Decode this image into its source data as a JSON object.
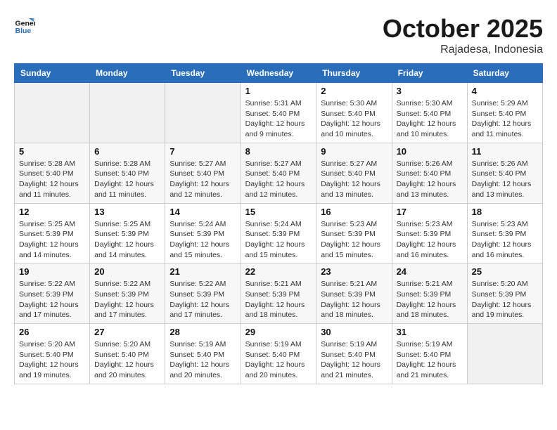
{
  "header": {
    "logo_line1": "General",
    "logo_line2": "Blue",
    "month": "October 2025",
    "location": "Rajadesa, Indonesia"
  },
  "weekdays": [
    "Sunday",
    "Monday",
    "Tuesday",
    "Wednesday",
    "Thursday",
    "Friday",
    "Saturday"
  ],
  "weeks": [
    [
      {
        "day": "",
        "sunrise": "",
        "sunset": "",
        "daylight": ""
      },
      {
        "day": "",
        "sunrise": "",
        "sunset": "",
        "daylight": ""
      },
      {
        "day": "",
        "sunrise": "",
        "sunset": "",
        "daylight": ""
      },
      {
        "day": "1",
        "sunrise": "Sunrise: 5:31 AM",
        "sunset": "Sunset: 5:40 PM",
        "daylight": "Daylight: 12 hours and 9 minutes."
      },
      {
        "day": "2",
        "sunrise": "Sunrise: 5:30 AM",
        "sunset": "Sunset: 5:40 PM",
        "daylight": "Daylight: 12 hours and 10 minutes."
      },
      {
        "day": "3",
        "sunrise": "Sunrise: 5:30 AM",
        "sunset": "Sunset: 5:40 PM",
        "daylight": "Daylight: 12 hours and 10 minutes."
      },
      {
        "day": "4",
        "sunrise": "Sunrise: 5:29 AM",
        "sunset": "Sunset: 5:40 PM",
        "daylight": "Daylight: 12 hours and 11 minutes."
      }
    ],
    [
      {
        "day": "5",
        "sunrise": "Sunrise: 5:28 AM",
        "sunset": "Sunset: 5:40 PM",
        "daylight": "Daylight: 12 hours and 11 minutes."
      },
      {
        "day": "6",
        "sunrise": "Sunrise: 5:28 AM",
        "sunset": "Sunset: 5:40 PM",
        "daylight": "Daylight: 12 hours and 11 minutes."
      },
      {
        "day": "7",
        "sunrise": "Sunrise: 5:27 AM",
        "sunset": "Sunset: 5:40 PM",
        "daylight": "Daylight: 12 hours and 12 minutes."
      },
      {
        "day": "8",
        "sunrise": "Sunrise: 5:27 AM",
        "sunset": "Sunset: 5:40 PM",
        "daylight": "Daylight: 12 hours and 12 minutes."
      },
      {
        "day": "9",
        "sunrise": "Sunrise: 5:27 AM",
        "sunset": "Sunset: 5:40 PM",
        "daylight": "Daylight: 12 hours and 13 minutes."
      },
      {
        "day": "10",
        "sunrise": "Sunrise: 5:26 AM",
        "sunset": "Sunset: 5:40 PM",
        "daylight": "Daylight: 12 hours and 13 minutes."
      },
      {
        "day": "11",
        "sunrise": "Sunrise: 5:26 AM",
        "sunset": "Sunset: 5:40 PM",
        "daylight": "Daylight: 12 hours and 13 minutes."
      }
    ],
    [
      {
        "day": "12",
        "sunrise": "Sunrise: 5:25 AM",
        "sunset": "Sunset: 5:39 PM",
        "daylight": "Daylight: 12 hours and 14 minutes."
      },
      {
        "day": "13",
        "sunrise": "Sunrise: 5:25 AM",
        "sunset": "Sunset: 5:39 PM",
        "daylight": "Daylight: 12 hours and 14 minutes."
      },
      {
        "day": "14",
        "sunrise": "Sunrise: 5:24 AM",
        "sunset": "Sunset: 5:39 PM",
        "daylight": "Daylight: 12 hours and 15 minutes."
      },
      {
        "day": "15",
        "sunrise": "Sunrise: 5:24 AM",
        "sunset": "Sunset: 5:39 PM",
        "daylight": "Daylight: 12 hours and 15 minutes."
      },
      {
        "day": "16",
        "sunrise": "Sunrise: 5:23 AM",
        "sunset": "Sunset: 5:39 PM",
        "daylight": "Daylight: 12 hours and 15 minutes."
      },
      {
        "day": "17",
        "sunrise": "Sunrise: 5:23 AM",
        "sunset": "Sunset: 5:39 PM",
        "daylight": "Daylight: 12 hours and 16 minutes."
      },
      {
        "day": "18",
        "sunrise": "Sunrise: 5:23 AM",
        "sunset": "Sunset: 5:39 PM",
        "daylight": "Daylight: 12 hours and 16 minutes."
      }
    ],
    [
      {
        "day": "19",
        "sunrise": "Sunrise: 5:22 AM",
        "sunset": "Sunset: 5:39 PM",
        "daylight": "Daylight: 12 hours and 17 minutes."
      },
      {
        "day": "20",
        "sunrise": "Sunrise: 5:22 AM",
        "sunset": "Sunset: 5:39 PM",
        "daylight": "Daylight: 12 hours and 17 minutes."
      },
      {
        "day": "21",
        "sunrise": "Sunrise: 5:22 AM",
        "sunset": "Sunset: 5:39 PM",
        "daylight": "Daylight: 12 hours and 17 minutes."
      },
      {
        "day": "22",
        "sunrise": "Sunrise: 5:21 AM",
        "sunset": "Sunset: 5:39 PM",
        "daylight": "Daylight: 12 hours and 18 minutes."
      },
      {
        "day": "23",
        "sunrise": "Sunrise: 5:21 AM",
        "sunset": "Sunset: 5:39 PM",
        "daylight": "Daylight: 12 hours and 18 minutes."
      },
      {
        "day": "24",
        "sunrise": "Sunrise: 5:21 AM",
        "sunset": "Sunset: 5:39 PM",
        "daylight": "Daylight: 12 hours and 18 minutes."
      },
      {
        "day": "25",
        "sunrise": "Sunrise: 5:20 AM",
        "sunset": "Sunset: 5:39 PM",
        "daylight": "Daylight: 12 hours and 19 minutes."
      }
    ],
    [
      {
        "day": "26",
        "sunrise": "Sunrise: 5:20 AM",
        "sunset": "Sunset: 5:40 PM",
        "daylight": "Daylight: 12 hours and 19 minutes."
      },
      {
        "day": "27",
        "sunrise": "Sunrise: 5:20 AM",
        "sunset": "Sunset: 5:40 PM",
        "daylight": "Daylight: 12 hours and 20 minutes."
      },
      {
        "day": "28",
        "sunrise": "Sunrise: 5:19 AM",
        "sunset": "Sunset: 5:40 PM",
        "daylight": "Daylight: 12 hours and 20 minutes."
      },
      {
        "day": "29",
        "sunrise": "Sunrise: 5:19 AM",
        "sunset": "Sunset: 5:40 PM",
        "daylight": "Daylight: 12 hours and 20 minutes."
      },
      {
        "day": "30",
        "sunrise": "Sunrise: 5:19 AM",
        "sunset": "Sunset: 5:40 PM",
        "daylight": "Daylight: 12 hours and 21 minutes."
      },
      {
        "day": "31",
        "sunrise": "Sunrise: 5:19 AM",
        "sunset": "Sunset: 5:40 PM",
        "daylight": "Daylight: 12 hours and 21 minutes."
      },
      {
        "day": "",
        "sunrise": "",
        "sunset": "",
        "daylight": ""
      }
    ]
  ]
}
